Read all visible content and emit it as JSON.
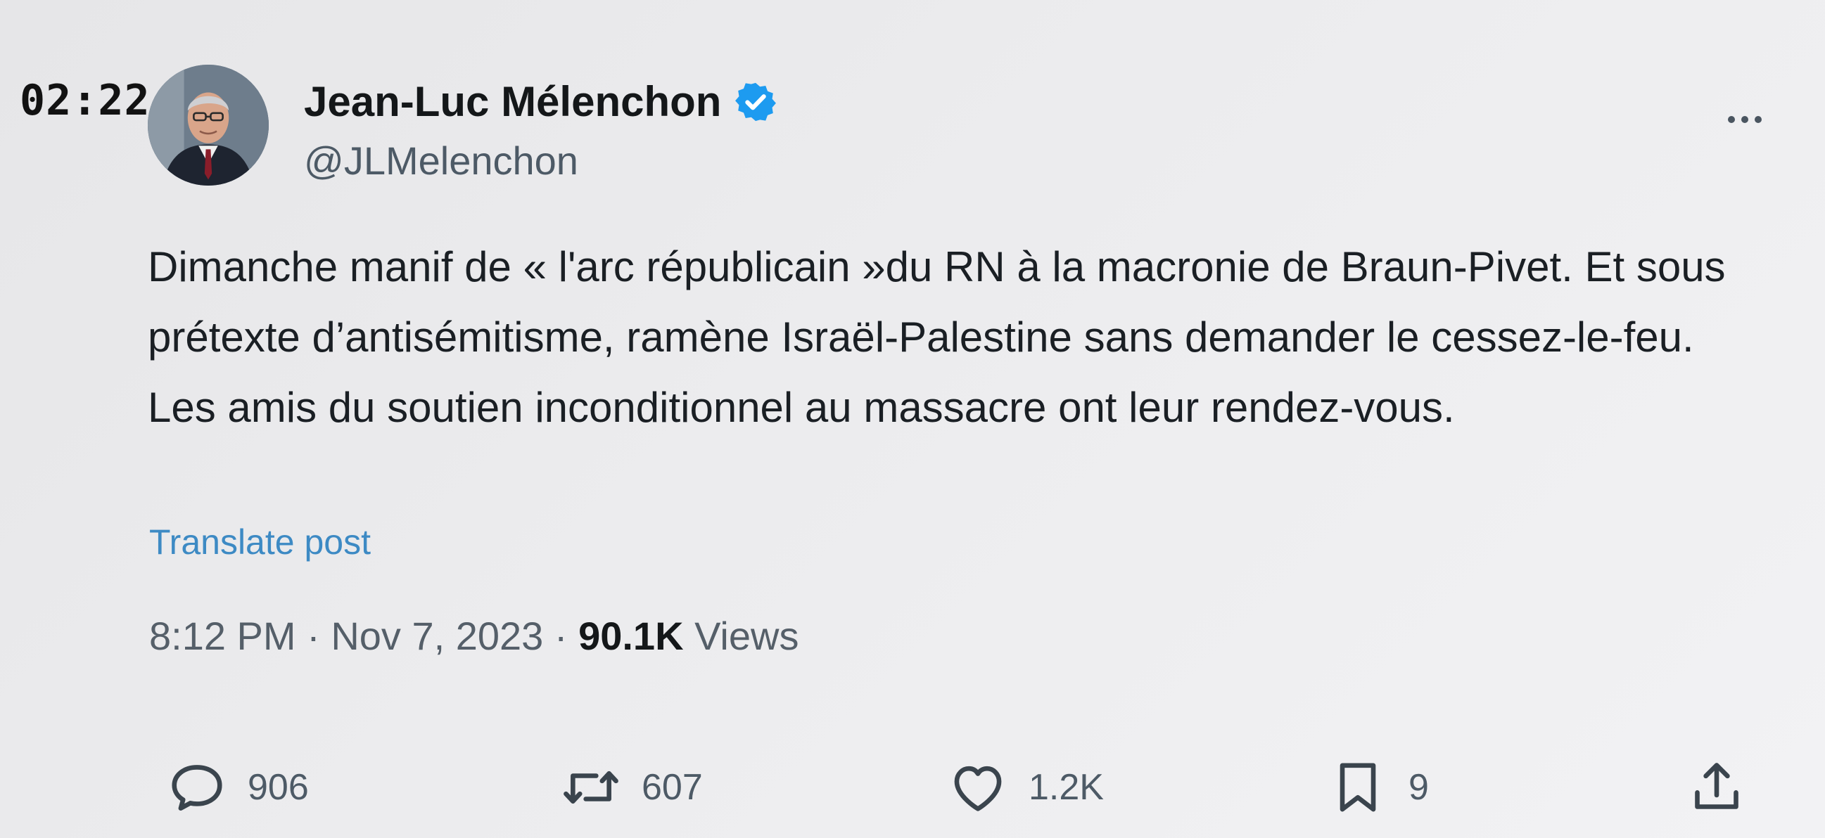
{
  "status_overlay": {
    "time": "02:22"
  },
  "author": {
    "name": "Jean-Luc Mélenchon",
    "handle": "@JLMelenchon",
    "verified": true
  },
  "post": {
    "text": "Dimanche manif de « l'arc républicain »du RN à la macronie de Braun-Pivet. Et sous prétexte d’antisémitisme, ramène Israël-Palestine sans demander le cessez-le-feu. Les amis du soutien inconditionnel au massacre ont leur rendez-vous.",
    "translate_label": "Translate post",
    "time": "8:12 PM",
    "separator": " · ",
    "date": "Nov 7, 2023",
    "views_count": "90.1K",
    "views_label": " Views"
  },
  "actions": {
    "reply_count": "906",
    "retweet_count": "607",
    "like_count": "1.2K",
    "bookmark_count": "9"
  },
  "icons": {
    "more": "more-icon",
    "verified": "verified-badge-icon",
    "reply": "reply-icon",
    "retweet": "retweet-icon",
    "like": "heart-icon",
    "bookmark": "bookmark-icon",
    "share": "share-icon"
  },
  "colors": {
    "verified_blue": "#1d9bf0",
    "link_blue": "#3d8ac4",
    "text_primary": "#1a1f24",
    "text_secondary": "#4d5a66"
  }
}
